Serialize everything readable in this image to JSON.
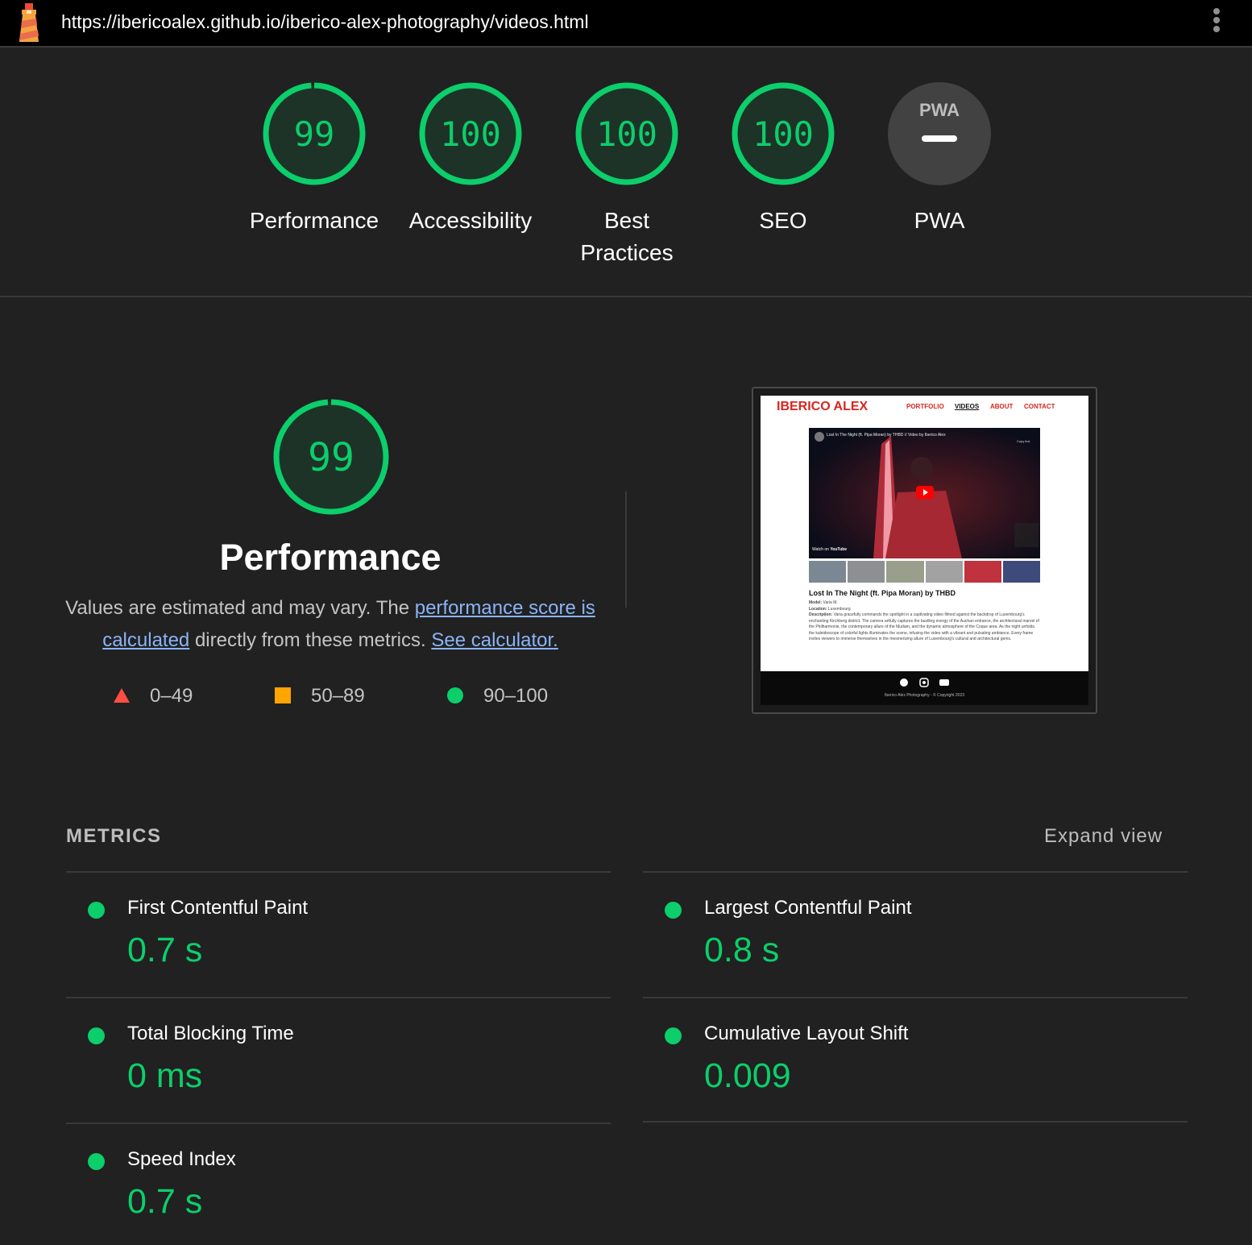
{
  "topbar": {
    "url": "https://ibericoalex.github.io/iberico-alex-photography/videos.html"
  },
  "colors": {
    "pass": "#0cce6b",
    "average": "#ffa400",
    "fail": "#ff4e42",
    "link": "#8ab4f8",
    "background": "#212121"
  },
  "gauges": [
    {
      "score": 99,
      "label": "Performance"
    },
    {
      "score": 100,
      "label": "Accessibility"
    },
    {
      "score": 100,
      "label": "Best Practices"
    },
    {
      "score": 100,
      "label": "SEO"
    },
    {
      "score": null,
      "label": "PWA",
      "badge": "PWA"
    }
  ],
  "performance": {
    "score": 99,
    "title": "Performance",
    "desc_prefix": "Values are estimated and may vary. The ",
    "desc_link1": "performance score is calculated",
    "desc_middle": " directly from these metrics. ",
    "desc_link2": "See calculator."
  },
  "legend": [
    {
      "range": "0–49",
      "shape": "triangle"
    },
    {
      "range": "50–89",
      "shape": "square"
    },
    {
      "range": "90–100",
      "shape": "circle"
    }
  ],
  "screenshot": {
    "brand": "IBERICO ALEX",
    "nav": [
      "PORTFOLIO",
      "VIDEOS",
      "ABOUT",
      "CONTACT"
    ],
    "video_title": "Lost In The Night (ft. Pipa Moran) by THBD // Video by Iberico Alex",
    "copy_link": "Copy link",
    "watch_on": "Watch on",
    "youtube": "YouTube",
    "heading": "Lost In The Night (ft. Pipa Moran) by THBD",
    "model_label": "Model:",
    "model": "Varia M.",
    "location_label": "Location:",
    "location": "Luxembourg",
    "description_label": "Description:",
    "description": "Varia gracefully commands the spotlight in a captivating video filmed against the backdrop of Luxembourg's enchanting Kirchberg district. The camera artfully captures the bustling energy of the Auchan entrance, the architectural marvel of the Philharmonie, the contemporary allure of the Mudam, and the dynamic atmosphere of the Coque area. As the night unfolds, the kaleidoscope of colorful lights illuminates the scene, infusing the video with a vibrant and pulsating ambiance. Every frame invites viewers to immerse themselves in the mesmerizing allure of Luxembourg's cultural and architectural gems.",
    "footer_copy": "Iberico Alex Photography - © Copyright 2023"
  },
  "metrics": {
    "heading": "METRICS",
    "expand_label": "Expand view",
    "items": [
      {
        "title": "First Contentful Paint",
        "value": "0.7 s"
      },
      {
        "title": "Largest Contentful Paint",
        "value": "0.8 s"
      },
      {
        "title": "Total Blocking Time",
        "value": "0 ms"
      },
      {
        "title": "Cumulative Layout Shift",
        "value": "0.009"
      },
      {
        "title": "Speed Index",
        "value": "0.7 s"
      }
    ]
  }
}
